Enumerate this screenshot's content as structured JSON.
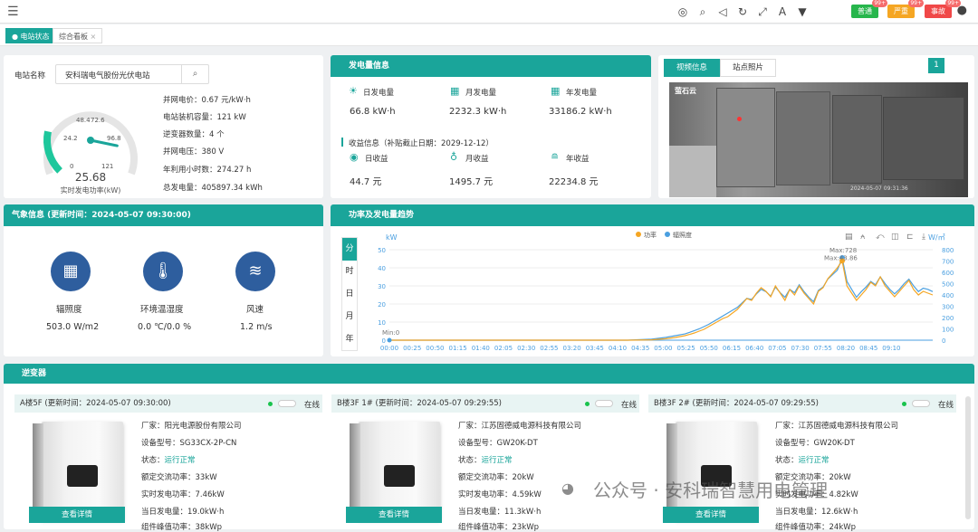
{
  "topbar": {
    "alerts": [
      {
        "label": "普通",
        "count": "99+",
        "color": "#27b64c"
      },
      {
        "label": "严重",
        "count": "99+",
        "color": "#f5a623"
      },
      {
        "label": "事故",
        "count": "99+",
        "color": "#f04848"
      }
    ]
  },
  "tabs": [
    {
      "label": "电站状态"
    },
    {
      "label": "综合看板"
    }
  ],
  "station": {
    "name_label": "电站名称",
    "name_value": "安科瑞电气股份光伏电站",
    "gauge_value": "25.68",
    "gauge_label": "实时发电功率(kW)",
    "gauge_ticks": [
      "0",
      "24.2",
      "48.4",
      "72.6",
      "96.8",
      "121"
    ],
    "gauge_fraction": 0.21,
    "info": [
      "并网电价：0.67 元/kW·h",
      "电站装机容量：121 kW",
      "逆变器数量：4 个",
      "并网电压：380 V",
      "年利用小时数：274.27 h",
      "总发电量：405897.34 kWh"
    ]
  },
  "generation": {
    "title": "发电量信息",
    "day_label": "日发电量",
    "day_value": "66.8 kW·h",
    "month_label": "月发电量",
    "month_value": "2232.3 kW·h",
    "year_label": "年发电量",
    "year_value": "33186.2 kW·h",
    "income_title": "收益信息（补贴截止日期：2029-12-12）",
    "inc_day_label": "日收益",
    "inc_day_value": "44.7 元",
    "inc_month_label": "月收益",
    "inc_month_value": "1495.7 元",
    "inc_year_label": "年收益",
    "inc_year_value": "22234.8 元"
  },
  "video": {
    "tab1": "视频信息",
    "tab2": "站点照片",
    "page": "1",
    "logo": "萤石云",
    "stamp": "2024-05-07 09:31:36"
  },
  "weather": {
    "title": "气象信息 (更新时间：2024-05-07 09:30:00)",
    "items": [
      {
        "icon": "solar-panel-icon",
        "label": "辐照度",
        "value": "503.0 W/m2"
      },
      {
        "icon": "thermometer-icon",
        "label": "环境温湿度",
        "value": "0.0 ℃/0.0 %"
      },
      {
        "icon": "wind-icon",
        "label": "风速",
        "value": "1.2 m/s"
      }
    ]
  },
  "trend": {
    "title": "功率及发电量趋势",
    "periods": [
      "分",
      "时",
      "日",
      "月",
      "年"
    ]
  },
  "chart_data": {
    "type": "line",
    "y_left_unit": "kW",
    "y_right_unit": "W/㎡",
    "ylim_left": [
      0,
      50
    ],
    "ylim_right": [
      0,
      800
    ],
    "legend": [
      "功率",
      "辐照度"
    ],
    "series_colors": [
      "#f5a623",
      "#4a9fe0"
    ],
    "x_ticks": [
      "00:00",
      "00:25",
      "00:50",
      "01:15",
      "01:40",
      "02:05",
      "02:30",
      "02:55",
      "03:20",
      "03:45",
      "04:10",
      "04:35",
      "05:00",
      "05:25",
      "05:50",
      "06:15",
      "06:40",
      "07:05",
      "07:30",
      "07:55",
      "08:20",
      "08:45",
      "09:10"
    ],
    "y_left_ticks": [
      "0",
      "10",
      "20",
      "30",
      "40",
      "50"
    ],
    "y_right_ticks": [
      "0",
      "100",
      "200",
      "300",
      "400",
      "500",
      "600",
      "700",
      "800"
    ],
    "marks": {
      "min": "Min:0",
      "max_irr": "Max:728",
      "max_pow": "Max:43.86"
    },
    "x": [
      0,
      50,
      100,
      150,
      200,
      250,
      275,
      290,
      300,
      310,
      315,
      320,
      325,
      330,
      335,
      340,
      345,
      350,
      355,
      360,
      365,
      370,
      375,
      380,
      385,
      390,
      395,
      400,
      405,
      410,
      415,
      420,
      425,
      430,
      435,
      440,
      445,
      450,
      455,
      460,
      465,
      470,
      475,
      480,
      485,
      490,
      495,
      500,
      505,
      510,
      515,
      520,
      525,
      530,
      535,
      540,
      545,
      550,
      555,
      560,
      565,
      570
    ],
    "power": [
      0,
      0,
      0,
      0,
      0,
      0,
      0.2,
      0.8,
      1.5,
      2.5,
      3.2,
      4,
      5,
      6,
      7.5,
      9,
      10.5,
      12,
      13,
      15,
      17,
      20,
      23,
      22,
      26,
      29,
      27,
      24,
      30,
      26,
      22,
      28,
      25,
      30,
      26,
      23,
      20,
      27,
      29,
      34,
      37,
      40,
      43.86,
      30,
      26,
      22,
      25,
      28,
      32,
      30,
      35,
      30,
      27,
      24,
      27,
      30,
      33,
      28,
      25,
      27,
      26,
      25
    ],
    "irradiance": [
      0,
      0,
      0,
      0,
      0,
      0,
      10,
      25,
      40,
      55,
      70,
      85,
      100,
      120,
      140,
      165,
      190,
      215,
      240,
      265,
      290,
      330,
      370,
      360,
      410,
      450,
      430,
      390,
      470,
      420,
      380,
      450,
      420,
      490,
      430,
      380,
      340,
      440,
      470,
      540,
      580,
      620,
      728,
      520,
      450,
      380,
      430,
      470,
      520,
      490,
      560,
      500,
      450,
      410,
      450,
      500,
      540,
      480,
      430,
      460,
      450,
      430
    ]
  },
  "inverter": {
    "title": "逆变器",
    "detail_label": "查看详情",
    "online_label": "在线",
    "cards": [
      {
        "header": "A楼5F (更新时间：2024-05-07 09:30:00)",
        "rows": [
          "厂家：阳光电源股份有限公司",
          "设备型号：SG33CX-2P-CN"
        ],
        "status_label": "状态：",
        "status": "运行正常",
        "rows2": [
          "额定交流功率：33kW",
          "实时发电功率：7.46kW",
          "当日发电量：19.0kW·h",
          "组件峰值功率：38kWp"
        ]
      },
      {
        "header": "B楼3F 1# (更新时间：2024-05-07 09:29:55)",
        "rows": [
          "厂家：江苏固德威电源科技有限公司",
          "设备型号：GW20K-DT"
        ],
        "status_label": "状态：",
        "status": "运行正常",
        "rows2": [
          "额定交流功率：20kW",
          "实时发电功率：4.59kW",
          "当日发电量：11.3kW·h",
          "组件峰值功率：23kWp"
        ]
      },
      {
        "header": "B楼3F 2# (更新时间：2024-05-07 09:29:55)",
        "rows": [
          "厂家：江苏固德威电源科技有限公司",
          "设备型号：GW20K-DT"
        ],
        "status_label": "状态：",
        "status": "运行正常",
        "rows2": [
          "额定交流功率：20kW",
          "实时发电功率：4.82kW",
          "当日发电量：12.6kW·h",
          "组件峰值功率：24kWp"
        ]
      }
    ]
  },
  "watermark": "公众号 · 安科瑞智慧用电管理"
}
